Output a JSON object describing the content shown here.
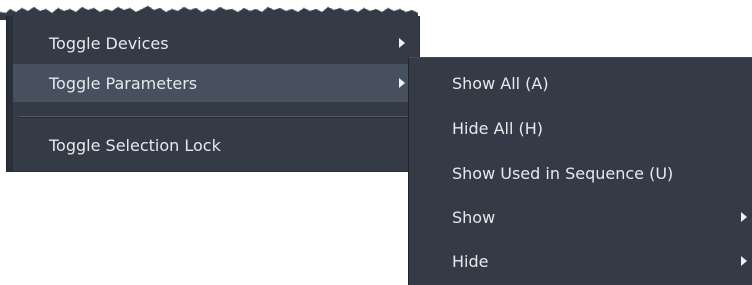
{
  "menu": {
    "items": [
      {
        "label": "Toggle Devices",
        "has_submenu": true,
        "icon": "chevron-right-icon"
      },
      {
        "label": "Toggle Parameters",
        "has_submenu": true,
        "highlighted": true,
        "icon": "chevron-right-icon"
      },
      {
        "label": "Toggle Selection Lock",
        "has_submenu": false
      }
    ]
  },
  "submenu": {
    "items": [
      {
        "label": "Show All (A)",
        "has_submenu": false
      },
      {
        "label": "Hide All (H)",
        "has_submenu": false
      },
      {
        "label": "Show Used in Sequence (U)",
        "has_submenu": false
      },
      {
        "label": "Show",
        "has_submenu": true,
        "icon": "chevron-right-icon"
      },
      {
        "label": "Hide",
        "has_submenu": true,
        "icon": "chevron-right-icon"
      }
    ]
  },
  "colors": {
    "menu_background": "#343b47",
    "highlight_background": "#46505f",
    "text": "#e6e8ec",
    "separator": "#555e6b"
  }
}
